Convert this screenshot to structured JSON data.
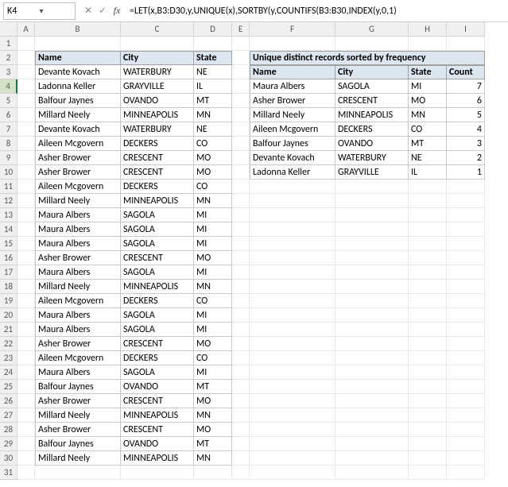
{
  "namebox": "K4",
  "formula": "=LET(x,B3:D30,y,UNIQUE(x),SORTBY(y,COUNTIFS(B3:B30,INDEX(y,0,1)",
  "col_headers": [
    "A",
    "B",
    "C",
    "D",
    "E",
    "F",
    "G",
    "H",
    "I"
  ],
  "row_headers": [
    "1",
    "2",
    "3",
    "4",
    "5",
    "6",
    "7",
    "8",
    "9",
    "10",
    "11",
    "12",
    "13",
    "14",
    "15",
    "16",
    "17",
    "18",
    "19",
    "20",
    "21",
    "22",
    "23",
    "24",
    "25",
    "26",
    "27",
    "28",
    "29",
    "30",
    "31"
  ],
  "left_table": {
    "headers": [
      "Name",
      "City",
      "State"
    ],
    "rows": [
      [
        "Devante Kovach",
        "WATERBURY",
        "NE"
      ],
      [
        "Ladonna Keller",
        "GRAYVILLE",
        "IL"
      ],
      [
        "Balfour Jaynes",
        "OVANDO",
        "MT"
      ],
      [
        "Millard Neely",
        "MINNEAPOLIS",
        "MN"
      ],
      [
        "Devante Kovach",
        "WATERBURY",
        "NE"
      ],
      [
        "Aileen Mcgovern",
        "DECKERS",
        "CO"
      ],
      [
        "Asher Brower",
        "CRESCENT",
        "MO"
      ],
      [
        "Asher Brower",
        "CRESCENT",
        "MO"
      ],
      [
        "Aileen Mcgovern",
        "DECKERS",
        "CO"
      ],
      [
        "Millard Neely",
        "MINNEAPOLIS",
        "MN"
      ],
      [
        "Maura Albers",
        "SAGOLA",
        "MI"
      ],
      [
        "Maura Albers",
        "SAGOLA",
        "MI"
      ],
      [
        "Maura Albers",
        "SAGOLA",
        "MI"
      ],
      [
        "Asher Brower",
        "CRESCENT",
        "MO"
      ],
      [
        "Maura Albers",
        "SAGOLA",
        "MI"
      ],
      [
        "Millard Neely",
        "MINNEAPOLIS",
        "MN"
      ],
      [
        "Aileen Mcgovern",
        "DECKERS",
        "CO"
      ],
      [
        "Maura Albers",
        "SAGOLA",
        "MI"
      ],
      [
        "Maura Albers",
        "SAGOLA",
        "MI"
      ],
      [
        "Asher Brower",
        "CRESCENT",
        "MO"
      ],
      [
        "Aileen Mcgovern",
        "DECKERS",
        "CO"
      ],
      [
        "Maura Albers",
        "SAGOLA",
        "MI"
      ],
      [
        "Balfour Jaynes",
        "OVANDO",
        "MT"
      ],
      [
        "Asher Brower",
        "CRESCENT",
        "MO"
      ],
      [
        "Millard Neely",
        "MINNEAPOLIS",
        "MN"
      ],
      [
        "Asher Brower",
        "CRESCENT",
        "MO"
      ],
      [
        "Balfour Jaynes",
        "OVANDO",
        "MT"
      ],
      [
        "Millard Neely",
        "MINNEAPOLIS",
        "MN"
      ]
    ]
  },
  "right_table": {
    "title": "Unique distinct records sorted by frequency",
    "headers": [
      "Name",
      "City",
      "State",
      "Count"
    ],
    "rows": [
      [
        "Maura Albers",
        "SAGOLA",
        "MI",
        "7"
      ],
      [
        "Asher Brower",
        "CRESCENT",
        "MO",
        "6"
      ],
      [
        "Millard Neely",
        "MINNEAPOLIS",
        "MN",
        "5"
      ],
      [
        "Aileen Mcgovern",
        "DECKERS",
        "CO",
        "4"
      ],
      [
        "Balfour Jaynes",
        "OVANDO",
        "MT",
        "3"
      ],
      [
        "Devante Kovach",
        "WATERBURY",
        "NE",
        "2"
      ],
      [
        "Ladonna Keller",
        "GRAYVILLE",
        "IL",
        "1"
      ]
    ]
  },
  "selected_row": 4
}
